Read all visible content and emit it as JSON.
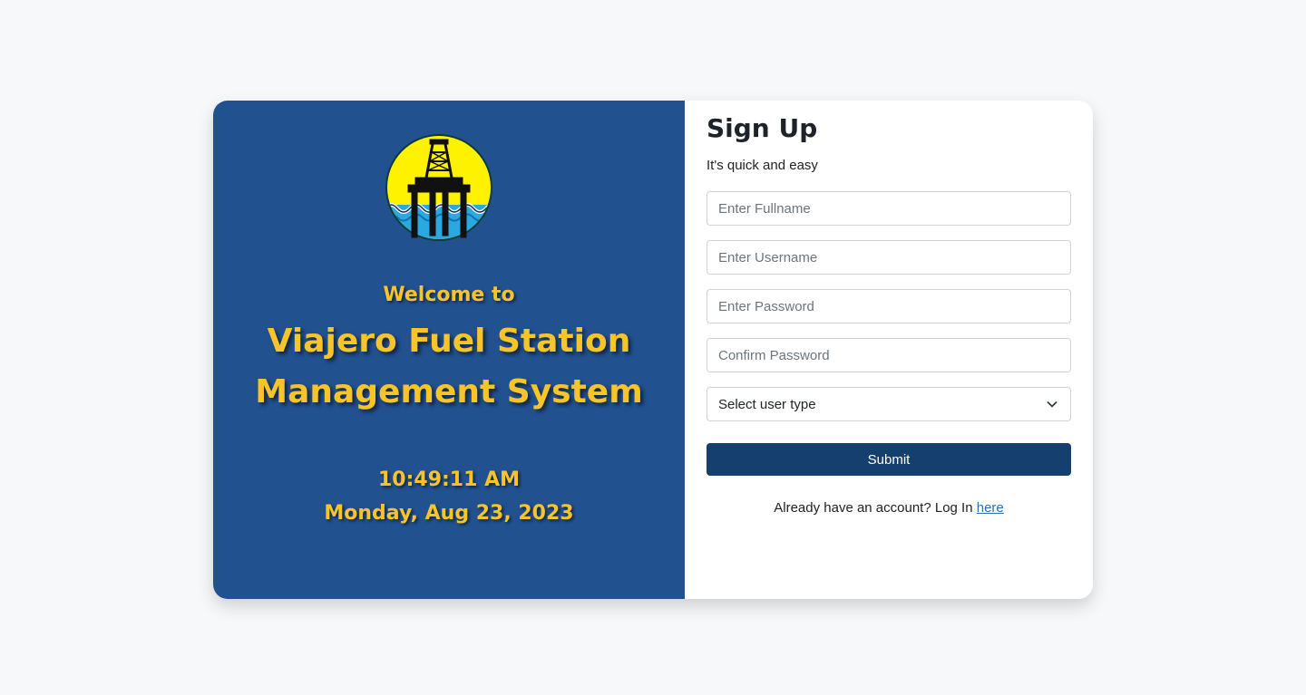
{
  "branding": {
    "welcome": "Welcome to",
    "app_name_line1": "Viajero Fuel Station",
    "app_name_line2": "Management System",
    "logo_icon": "oil-rig-logo-icon",
    "accent_color": "#f7c52a",
    "panel_color": "#225190"
  },
  "clock": {
    "time": "10:49:11 AM",
    "date": "Monday, Aug 23, 2023"
  },
  "form": {
    "title": "Sign Up",
    "subtitle": "It's quick and easy",
    "fullname_placeholder": "Enter Fullname",
    "username_placeholder": "Enter Username",
    "password_placeholder": "Enter Password",
    "confirm_placeholder": "Confirm Password",
    "user_type_selected": "Select user type",
    "submit_label": "Submit",
    "login_prompt": "Already have an account? Log In ",
    "login_link": "here",
    "button_color": "#153f6e"
  }
}
